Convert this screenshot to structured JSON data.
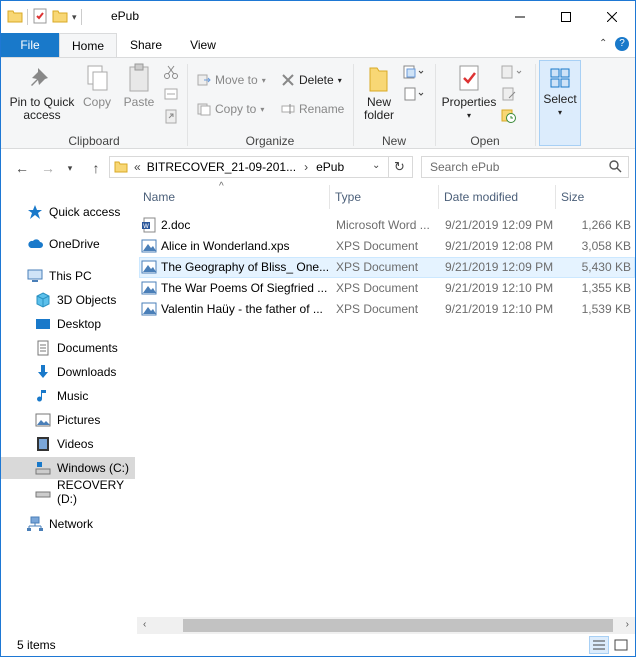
{
  "window": {
    "title": "ePub"
  },
  "ribbon_tabs": [
    {
      "label": "File"
    },
    {
      "label": "Home"
    },
    {
      "label": "Share"
    },
    {
      "label": "View"
    }
  ],
  "ribbon": {
    "clipboard": {
      "label": "Clipboard",
      "pin_label_1": "Pin to Quick",
      "pin_label_2": "access",
      "copy": "Copy",
      "paste": "Paste"
    },
    "organize": {
      "label": "Organize",
      "move_to": "Move to",
      "copy_to": "Copy to",
      "delete": "Delete",
      "rename": "Rename"
    },
    "new": {
      "label": "New",
      "new_folder_1": "New",
      "new_folder_2": "folder"
    },
    "open": {
      "label": "Open",
      "properties": "Properties"
    },
    "select": {
      "label": "Select"
    }
  },
  "address": {
    "crumb_prefix": "«",
    "crumb_1": "BITRECOVER_21-09-201...",
    "crumb_sep": "›",
    "crumb_2": "ePub",
    "search_placeholder": "Search ePub"
  },
  "nav": [
    {
      "label": "Quick access"
    },
    {
      "label": "OneDrive"
    },
    {
      "label": "This PC"
    },
    {
      "label": "3D Objects"
    },
    {
      "label": "Desktop"
    },
    {
      "label": "Documents"
    },
    {
      "label": "Downloads"
    },
    {
      "label": "Music"
    },
    {
      "label": "Pictures"
    },
    {
      "label": "Videos"
    },
    {
      "label": "Windows (C:)"
    },
    {
      "label": "RECOVERY (D:)"
    },
    {
      "label": "Network"
    }
  ],
  "columns": {
    "name": "Name",
    "type": "Type",
    "date": "Date modified",
    "size": "Size"
  },
  "files": [
    {
      "name": "2.doc",
      "type": "Microsoft Word ...",
      "date": "9/21/2019 12:09 PM",
      "size": "1,266 KB"
    },
    {
      "name": "Alice in Wonderland.xps",
      "type": "XPS Document",
      "date": "9/21/2019 12:08 PM",
      "size": "3,058 KB"
    },
    {
      "name": "The Geography of Bliss_ One...",
      "type": "XPS Document",
      "date": "9/21/2019 12:09 PM",
      "size": "5,430 KB"
    },
    {
      "name": "The War Poems Of Siegfried ...",
      "type": "XPS Document",
      "date": "9/21/2019 12:10 PM",
      "size": "1,355 KB"
    },
    {
      "name": "Valentin Haüy - the father of ...",
      "type": "XPS Document",
      "date": "9/21/2019 12:10 PM",
      "size": "1,539 KB"
    }
  ],
  "status": {
    "items": "5 items"
  },
  "colors": {
    "accent": "#1979ca",
    "selected_row": "#e5f3ff",
    "folder": "#f8d775"
  }
}
